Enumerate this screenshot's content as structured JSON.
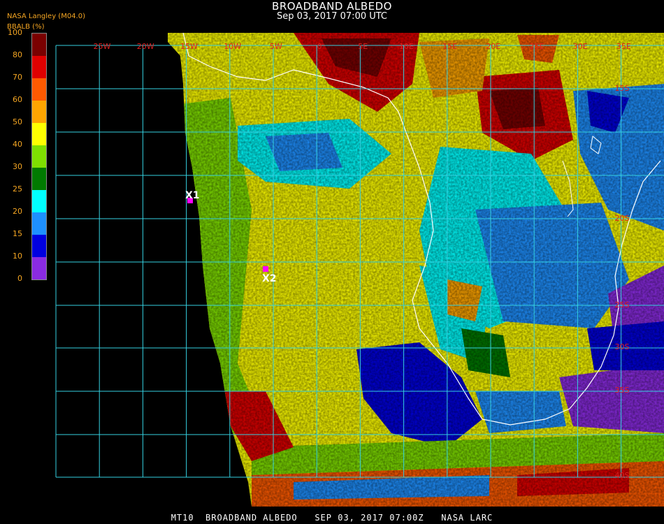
{
  "header": {
    "title": "BROADBAND ALBEDO",
    "subtitle": "Sep 03, 2017 07:00 UTC",
    "org": "NASA Langley (M04.0)"
  },
  "colorbar": {
    "title": "BBALB (%)",
    "ticks": [
      "100",
      "80",
      "70",
      "60",
      "50",
      "40",
      "30",
      "25",
      "20",
      "15",
      "10",
      "0"
    ],
    "colors": [
      "#7a0000",
      "#e00000",
      "#ff5a00",
      "#ffa500",
      "#ffff00",
      "#7fdf00",
      "#007a00",
      "#00ffff",
      "#1e90ff",
      "#0000e0",
      "#8a2be2"
    ]
  },
  "map": {
    "lon_labels": [
      "25W",
      "20W",
      "15W",
      "10W",
      "5W",
      "0",
      "5E",
      "10E",
      "15E",
      "20E",
      "25E",
      "30E",
      "35E"
    ],
    "lat_labels_right": [
      "15S",
      "20S",
      "25S",
      "30S",
      "35S",
      "40S"
    ],
    "markers": [
      {
        "id": "X1",
        "label": "X1",
        "color": "#ff00ff"
      },
      {
        "id": "X2",
        "label": "X2",
        "color": "#ff00ff"
      }
    ]
  },
  "footer": {
    "text": "MT10  BROADBAND ALBEDO   SEP 03, 2017 07:00Z   NASA LARC"
  }
}
